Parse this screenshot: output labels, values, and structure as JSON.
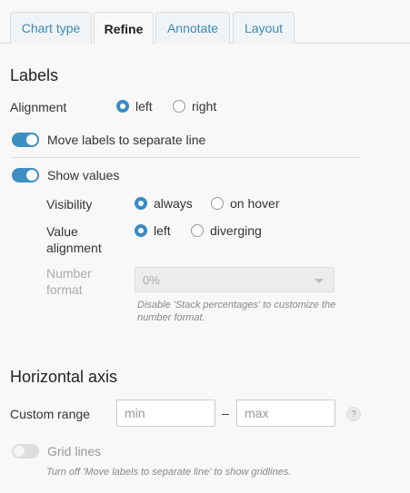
{
  "tabs": [
    {
      "label": "Chart type"
    },
    {
      "label": "Refine"
    },
    {
      "label": "Annotate"
    },
    {
      "label": "Layout"
    }
  ],
  "labels_section": {
    "title": "Labels",
    "alignment": {
      "label": "Alignment",
      "options": [
        "left",
        "right"
      ],
      "selected": "left"
    },
    "move_labels_toggle": {
      "label": "Move labels to separate line",
      "on": true
    }
  },
  "show_values": {
    "toggle": {
      "label": "Show values",
      "on": true
    },
    "visibility": {
      "label": "Visibility",
      "options": [
        "always",
        "on hover"
      ],
      "selected": "always"
    },
    "value_alignment": {
      "label_line1": "Value",
      "label_line2": "alignment",
      "options": [
        "left",
        "diverging"
      ],
      "selected": "left"
    },
    "number_format": {
      "label_line1": "Number",
      "label_line2": "format",
      "value": "0%",
      "disabled": true
    },
    "hint_line1": "Disable 'Stack percentages' to customize the",
    "hint_line2": "number format."
  },
  "horizontal_axis": {
    "title": "Horizontal axis",
    "custom_range": {
      "label": "Custom range",
      "min_placeholder": "min",
      "max_placeholder": "max",
      "separator": "–",
      "help": "?"
    },
    "grid_lines": {
      "label": "Grid lines",
      "on": false,
      "disabled": true
    },
    "hint": "Turn off 'Move labels to separate line' to show gridlines."
  },
  "colors": {
    "accent": "#3a8bc4",
    "tab_text": "#3a8bb7",
    "background": "#f8f8f8"
  }
}
